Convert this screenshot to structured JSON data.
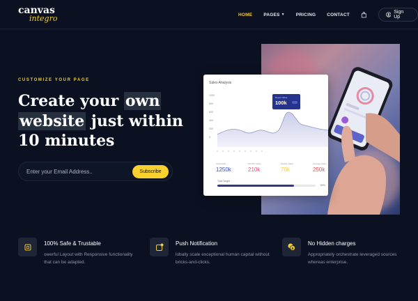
{
  "brand": {
    "name": "canvas",
    "sub": "integro",
    "accent": "#f3cd2d"
  },
  "nav": {
    "items": [
      {
        "label": "HOME",
        "active": true
      },
      {
        "label": "PAGES",
        "has_caret": true
      },
      {
        "label": "PRICING"
      },
      {
        "label": "CONTACT"
      }
    ],
    "cart_icon": "shopping-bag-icon",
    "signup_label": "Sign Up",
    "signup_icon": "user-circle-icon"
  },
  "hero": {
    "eyebrow": "CUSTOMIZE YOUR PAGE",
    "headline": {
      "part1": "Create your ",
      "highlight1": "own",
      "highlight2": "website",
      "part2": " just within",
      "line3": "10 minutes"
    },
    "email": {
      "value": "",
      "placeholder": "Enter your Email Address.."
    },
    "subscribe_label": "Subscribe"
  },
  "card": {
    "title": "Sales Analysis",
    "y_ticks": [
      "1000",
      "800",
      "600",
      "400",
      "200",
      "0"
    ],
    "tooltip": {
      "label": "Report Value",
      "value": "100k"
    },
    "stats": [
      {
        "label": "Total Sales",
        "value": "1250k",
        "color": "#3f51b5"
      },
      {
        "label": "Monthly Sales",
        "value": "210k",
        "color": "#e05585"
      },
      {
        "label": "Weekly Sales",
        "value": "70k",
        "color": "#f2c94c"
      },
      {
        "label": "Average Sales",
        "value": "250k",
        "color": "#e0575b"
      }
    ],
    "target": {
      "label": "Total Target",
      "progress": 0.78,
      "percent_text": "80%"
    }
  },
  "features": [
    {
      "icon": "chip-icon",
      "title": "100% Safe & Trustable",
      "desc": "owerful Layout with Responsive functionality that can be adapted."
    },
    {
      "icon": "notification-icon",
      "title": "Push Notification",
      "desc": "lobally scale exceptional human capital without bricks-and-clicks."
    },
    {
      "icon": "coins-icon",
      "title": "No Hidden charges",
      "desc": "Appropriately orchestrate leveraged sources whereas enterprise."
    }
  ]
}
